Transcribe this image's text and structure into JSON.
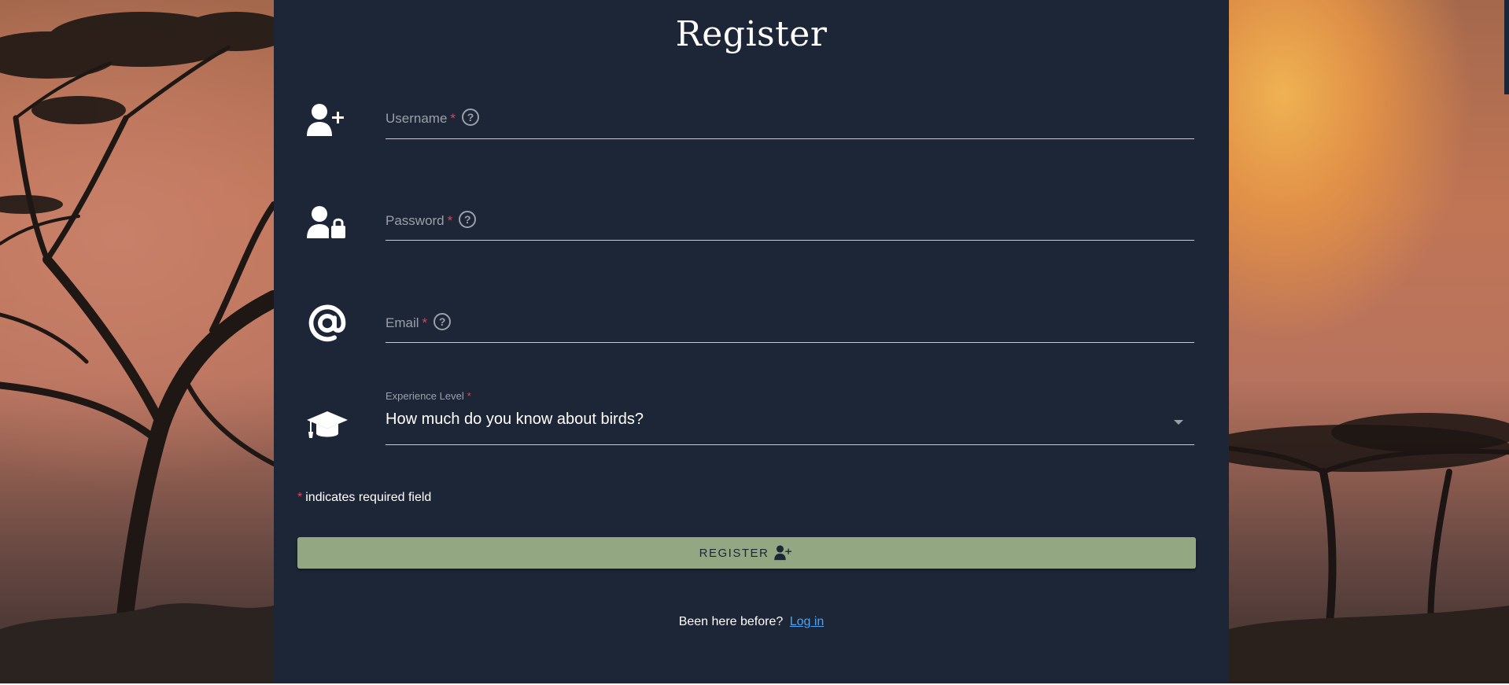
{
  "page": {
    "title": "Register"
  },
  "form": {
    "username": {
      "label": "Username",
      "required_mark": "*",
      "help_icon": "question-circle-icon",
      "icon": "user-plus-icon"
    },
    "password": {
      "label": "Password",
      "required_mark": "*",
      "help_icon": "question-circle-icon",
      "icon": "user-lock-icon"
    },
    "email": {
      "label": "Email",
      "required_mark": "*",
      "help_icon": "question-circle-icon",
      "icon": "at-sign-icon"
    },
    "experience": {
      "label": "Experience Level",
      "required_mark": "*",
      "selected": "How much do you know about birds?",
      "icon": "graduation-cap-icon"
    },
    "required_note": {
      "mark": "*",
      "text": "indicates required field"
    },
    "register_button": {
      "label": "REGISTER",
      "icon": "user-plus-icon"
    },
    "login_prompt": {
      "text": "Been here before?",
      "link": "Log in"
    }
  },
  "colors": {
    "panel": "#1d2637",
    "button": "#93a882",
    "required": "#e0425a",
    "link": "#4aa3f0"
  }
}
